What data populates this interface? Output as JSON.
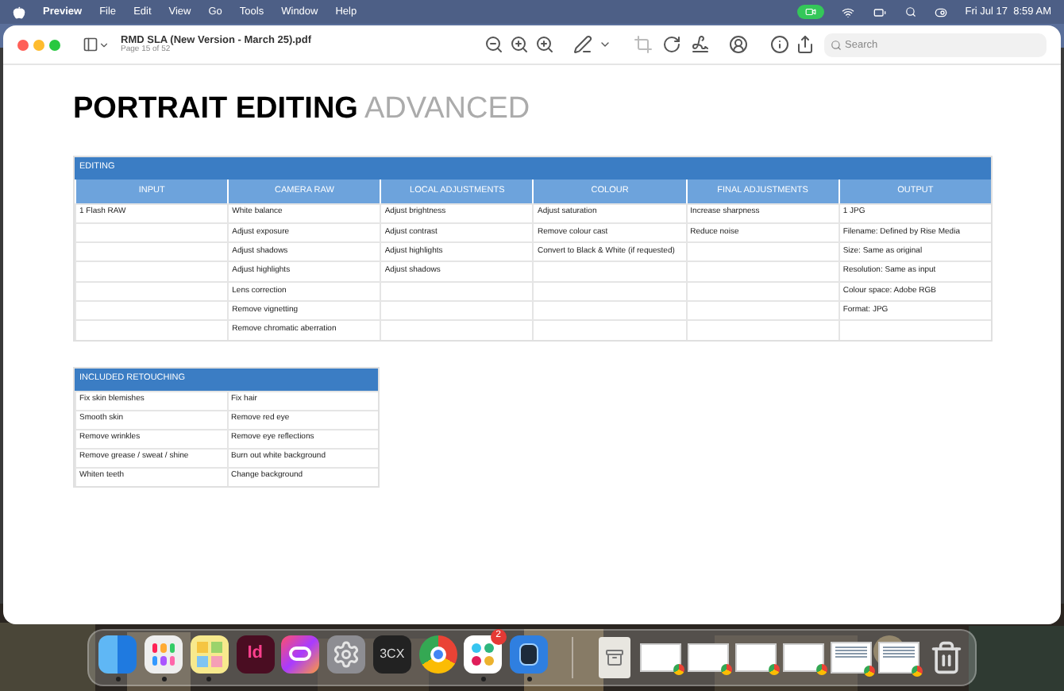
{
  "menu_bar": {
    "app": "Preview",
    "items": [
      "File",
      "Edit",
      "View",
      "Go",
      "Tools",
      "Window",
      "Help"
    ],
    "clock": "Fri Jul 17  8:59 AM"
  },
  "window": {
    "title": "RMD SLA (New Version - March 25).pdf",
    "subtitle": "Page 15 of 52",
    "search": {
      "placeholder": "Search"
    }
  },
  "document": {
    "heading": "PORTRAIT EDITING",
    "heading_suffix": "ADVANCED",
    "editing_table": {
      "title": "EDITING",
      "columns": [
        "INPUT",
        "CAMERA RAW",
        "LOCAL ADJUSTMENTS",
        "COLOUR",
        "FINAL ADJUSTMENTS",
        "OUTPUT"
      ],
      "rows": [
        [
          "1 Flash RAW",
          "White balance",
          "Adjust brightness",
          "Adjust saturation",
          "Increase sharpness",
          "1 JPG"
        ],
        [
          null,
          "Adjust exposure",
          "Adjust contrast",
          "Remove colour cast",
          "Reduce noise",
          "Filename: Defined by Rise Media"
        ],
        [
          null,
          "Adjust shadows",
          "Adjust highlights",
          "Convert to Black & White (if requested)",
          null,
          "Size: Same as original"
        ],
        [
          null,
          "Adjust highlights",
          "Adjust shadows",
          null,
          null,
          "Resolution: Same as input"
        ],
        [
          null,
          "Lens correction",
          null,
          null,
          null,
          "Colour space: Adobe RGB"
        ],
        [
          null,
          "Remove vignetting",
          null,
          null,
          null,
          "Format: JPG"
        ],
        [
          null,
          "Remove chromatic aberration",
          null,
          null,
          null,
          null
        ]
      ]
    },
    "retouching_table": {
      "title": "INCLUDED RETOUCHING",
      "rows": [
        [
          "Fix skin blemishes",
          "Fix hair"
        ],
        [
          "Smooth skin",
          "Remove red eye"
        ],
        [
          "Remove wrinkles",
          "Remove eye reflections"
        ],
        [
          "Remove grease / sweat / shine",
          "Burn out white background"
        ],
        [
          "Whiten teeth",
          "Change background"
        ]
      ]
    }
  },
  "dock": {
    "apps": [
      {
        "kind": "finder",
        "running": true
      },
      {
        "kind": "launchpad",
        "running": true
      },
      {
        "kind": "notes",
        "running": true
      },
      {
        "kind": "indesign",
        "label": "Id",
        "running": false
      },
      {
        "kind": "creative-cloud",
        "running": false
      },
      {
        "kind": "settings",
        "running": false
      },
      {
        "kind": "phone-app",
        "label": "3CX",
        "running": false
      },
      {
        "kind": "chrome",
        "running": false
      },
      {
        "kind": "slack",
        "badge": "2",
        "running": true
      },
      {
        "kind": "utility",
        "running": true
      }
    ],
    "stack": [
      {
        "kind": "archive"
      },
      {
        "kind": "document"
      },
      {
        "kind": "document"
      },
      {
        "kind": "document"
      },
      {
        "kind": "document"
      },
      {
        "kind": "spreadsheet"
      },
      {
        "kind": "spreadsheet"
      },
      {
        "kind": "trash"
      }
    ]
  }
}
